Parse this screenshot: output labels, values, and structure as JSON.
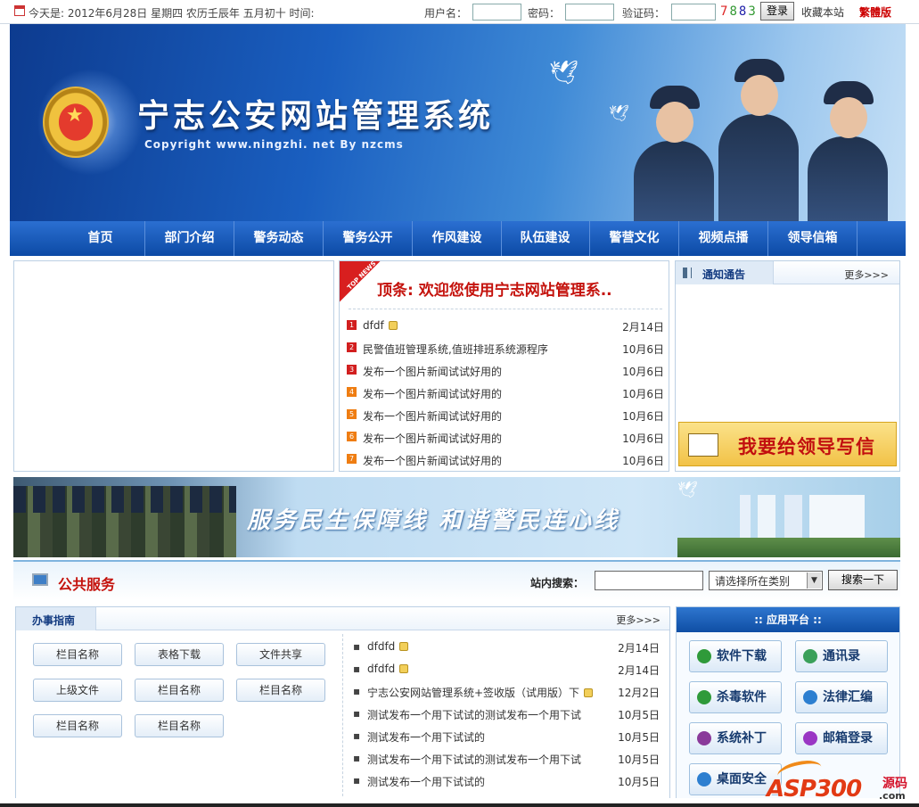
{
  "topbar": {
    "date_text": "今天是: 2012年6月28日 星期四 农历壬辰年 五月初十 时间:",
    "username_label": "用户名：",
    "password_label": "密码：",
    "captcha_label": "验证码：",
    "captcha_digits": [
      "7",
      "8",
      "8",
      "3"
    ],
    "login_label": "登录",
    "favorite_label": "收藏本站",
    "traditional_label": "繁體版"
  },
  "banner": {
    "title": "宁志公安网站管理系统",
    "copyright": "Copyright  www.ningzhi. net By nzcms"
  },
  "nav": {
    "items": [
      "首页",
      "部门介绍",
      "警务动态",
      "警务公开",
      "作风建设",
      "队伍建设",
      "警营文化",
      "视频点播",
      "领导信箱"
    ]
  },
  "news": {
    "ribbon_label": "TOP NEWS",
    "headline": "顶条: 欢迎您使用宁志网站管理系..",
    "items": [
      {
        "num": "1",
        "title": "dfdf",
        "lock": true,
        "date": "2月14日"
      },
      {
        "num": "2",
        "title": "民警值班管理系统,值班排班系统源程序",
        "lock": false,
        "date": "10月6日"
      },
      {
        "num": "3",
        "title": "发布一个图片新闻试试好用的",
        "lock": false,
        "date": "10月6日"
      },
      {
        "num": "4",
        "title": "发布一个图片新闻试试好用的",
        "lock": false,
        "date": "10月6日"
      },
      {
        "num": "5",
        "title": "发布一个图片新闻试试好用的",
        "lock": false,
        "date": "10月6日"
      },
      {
        "num": "6",
        "title": "发布一个图片新闻试试好用的",
        "lock": false,
        "date": "10月6日"
      },
      {
        "num": "7",
        "title": "发布一个图片新闻试试好用的",
        "lock": false,
        "date": "10月6日"
      }
    ],
    "badge_colors": [
      "#d21f1f",
      "#d21f1f",
      "#d21f1f",
      "#ef7d12",
      "#ef7d12",
      "#ef7d12",
      "#ef7d12"
    ]
  },
  "notice": {
    "title": "通知通告",
    "more": "更多>>>",
    "write_leader": "我要给领导写信"
  },
  "slogan": {
    "text": "服务民生保障线   和谐警民连心线"
  },
  "services": {
    "title": "公共服务",
    "search_label": "站内搜索：",
    "search_value": "",
    "category_selected": "请选择所在类别",
    "search_button": "搜索一下"
  },
  "guide": {
    "title": "办事指南",
    "more": "更多>>>",
    "buttons": [
      "栏目名称",
      "表格下载",
      "文件共享",
      "上级文件",
      "栏目名称",
      "栏目名称",
      "栏目名称",
      "栏目名称"
    ],
    "items": [
      {
        "title": "dfdfd",
        "lock": true,
        "date": "2月14日"
      },
      {
        "title": "dfdfd",
        "lock": true,
        "date": "2月14日"
      },
      {
        "title": "宁志公安网站管理系统+签收版（试用版）下",
        "lock": true,
        "date": "12月2日"
      },
      {
        "title": "测试发布一个用下试试的测试发布一个用下试",
        "lock": false,
        "date": "10月5日"
      },
      {
        "title": "测试发布一个用下试试的",
        "lock": false,
        "date": "10月5日"
      },
      {
        "title": "测试发布一个用下试试的测试发布一个用下试",
        "lock": false,
        "date": "10月5日"
      },
      {
        "title": "测试发布一个用下试试的",
        "lock": false,
        "date": "10月5日"
      }
    ]
  },
  "apps": {
    "title": ":: 应用平台 ::",
    "items": [
      {
        "label": "软件下载",
        "icon": "download-icon",
        "color": "#2f9a3a"
      },
      {
        "label": "通讯录",
        "icon": "phone-icon",
        "color": "#3aa05a"
      },
      {
        "label": "杀毒软件",
        "icon": "shield-icon",
        "color": "#2f9a3a"
      },
      {
        "label": "法律汇编",
        "icon": "book-icon",
        "color": "#2d7fd0"
      },
      {
        "label": "系统补丁",
        "icon": "patch-icon",
        "color": "#8a3a9a"
      },
      {
        "label": "邮箱登录",
        "icon": "mail-icon",
        "color": "#9a36c4"
      },
      {
        "label": "桌面安全",
        "icon": "desktop-icon",
        "color": "#2d7fd0"
      }
    ]
  },
  "watermark": {
    "brand": "ASP300",
    "cn": "源码",
    "domain": ".com"
  }
}
